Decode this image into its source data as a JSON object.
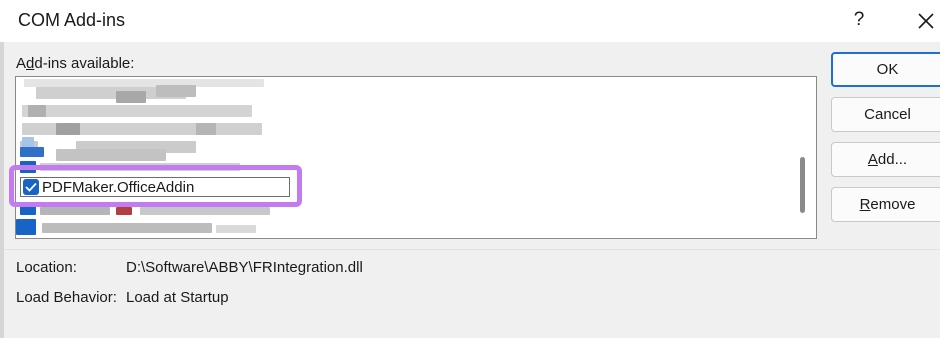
{
  "window": {
    "title": "COM Add-ins",
    "help_label": "?",
    "close_icon": "close-icon"
  },
  "list": {
    "label_prefix": "A",
    "label_underlined": "d",
    "label_suffix": "d-ins available:",
    "selected_item": {
      "label": "PDFMaker.OfficeAddin",
      "checked": true
    }
  },
  "buttons": {
    "ok": "OK",
    "cancel": "Cancel",
    "add_prefix": "",
    "add_underlined": "A",
    "add_suffix": "dd...",
    "remove_prefix": "",
    "remove_underlined": "R",
    "remove_suffix": "emove"
  },
  "details": {
    "location_label": "Location:",
    "location_value": "D:\\Software\\ABBY\\FRIntegration.dll",
    "load_behavior_label": "Load Behavior:",
    "load_behavior_value": "Load at Startup"
  },
  "colors": {
    "accent": "#1863c6",
    "highlight": "#c27cf0"
  }
}
